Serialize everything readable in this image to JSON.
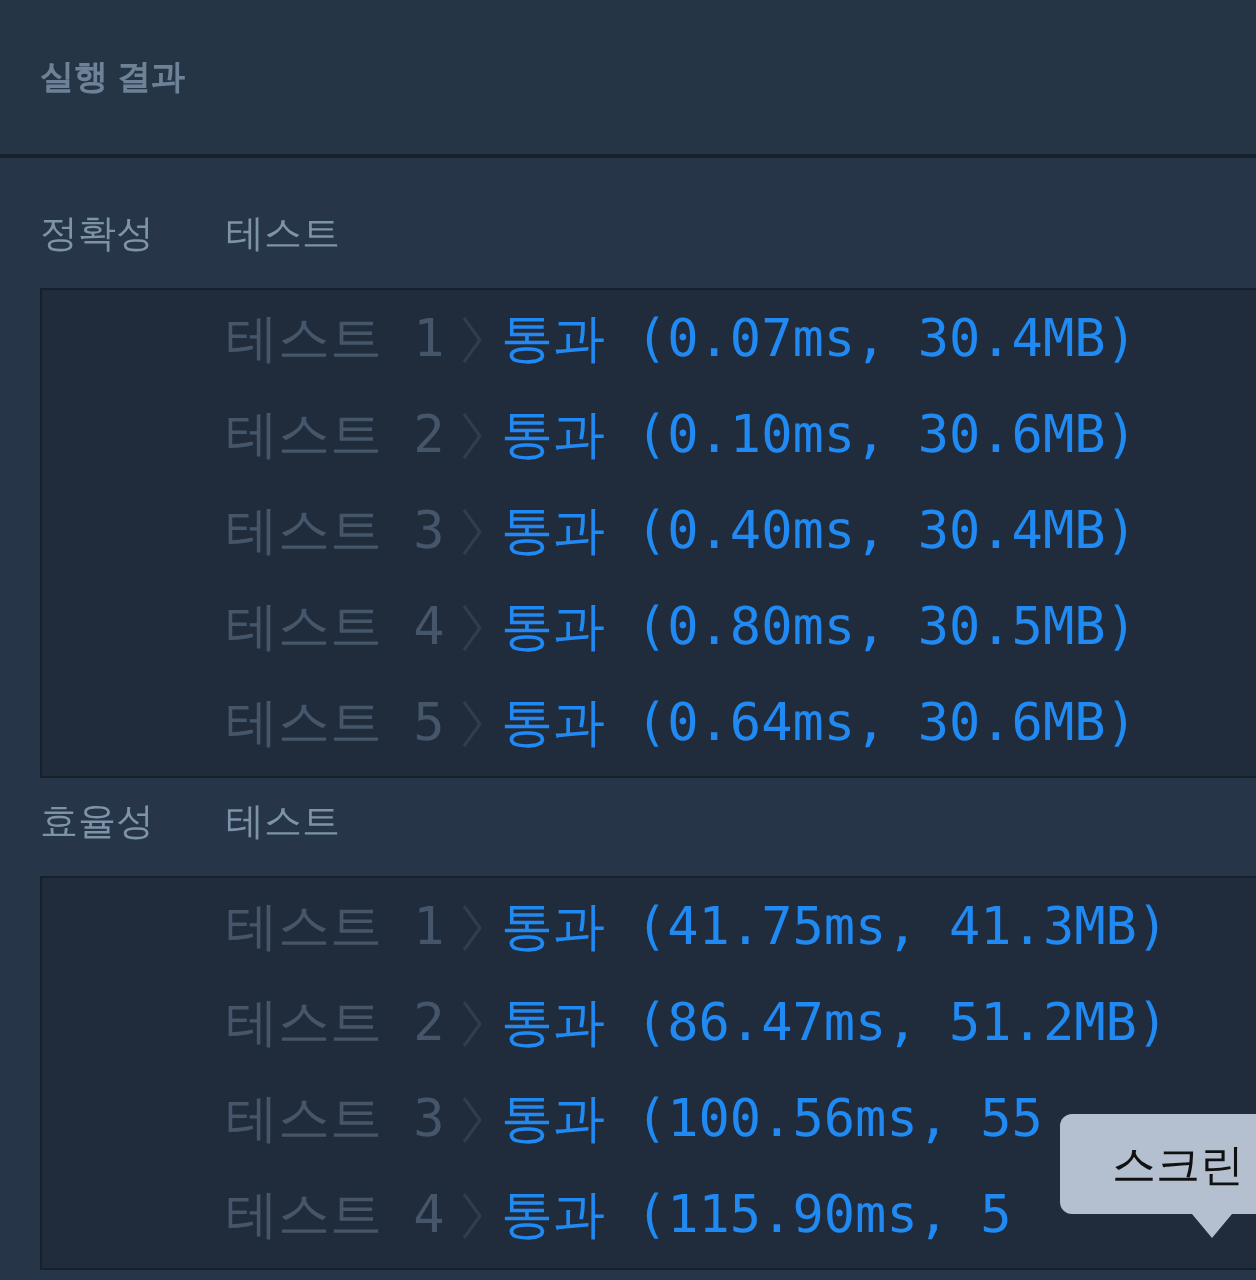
{
  "header": {
    "title": "실행 결과"
  },
  "sections": [
    {
      "category": "정확성",
      "label": "테스트",
      "rows": [
        {
          "name": "테스트 1",
          "result": "통과 (0.07ms, 30.4MB)"
        },
        {
          "name": "테스트 2",
          "result": "통과 (0.10ms, 30.6MB)"
        },
        {
          "name": "테스트 3",
          "result": "통과 (0.40ms, 30.4MB)"
        },
        {
          "name": "테스트 4",
          "result": "통과 (0.80ms, 30.5MB)"
        },
        {
          "name": "테스트 5",
          "result": "통과 (0.64ms, 30.6MB)"
        }
      ]
    },
    {
      "category": "효율성",
      "label": "테스트",
      "rows": [
        {
          "name": "테스트 1",
          "result": "통과 (41.75ms, 41.3MB)"
        },
        {
          "name": "테스트 2",
          "result": "통과 (86.47ms, 51.2MB)"
        },
        {
          "name": "테스트 3",
          "result": "통과 (100.56ms, 55"
        },
        {
          "name": "테스트 4",
          "result": "통과 (115.90ms, 5"
        }
      ]
    }
  ],
  "tooltip": {
    "text": "스크린"
  }
}
